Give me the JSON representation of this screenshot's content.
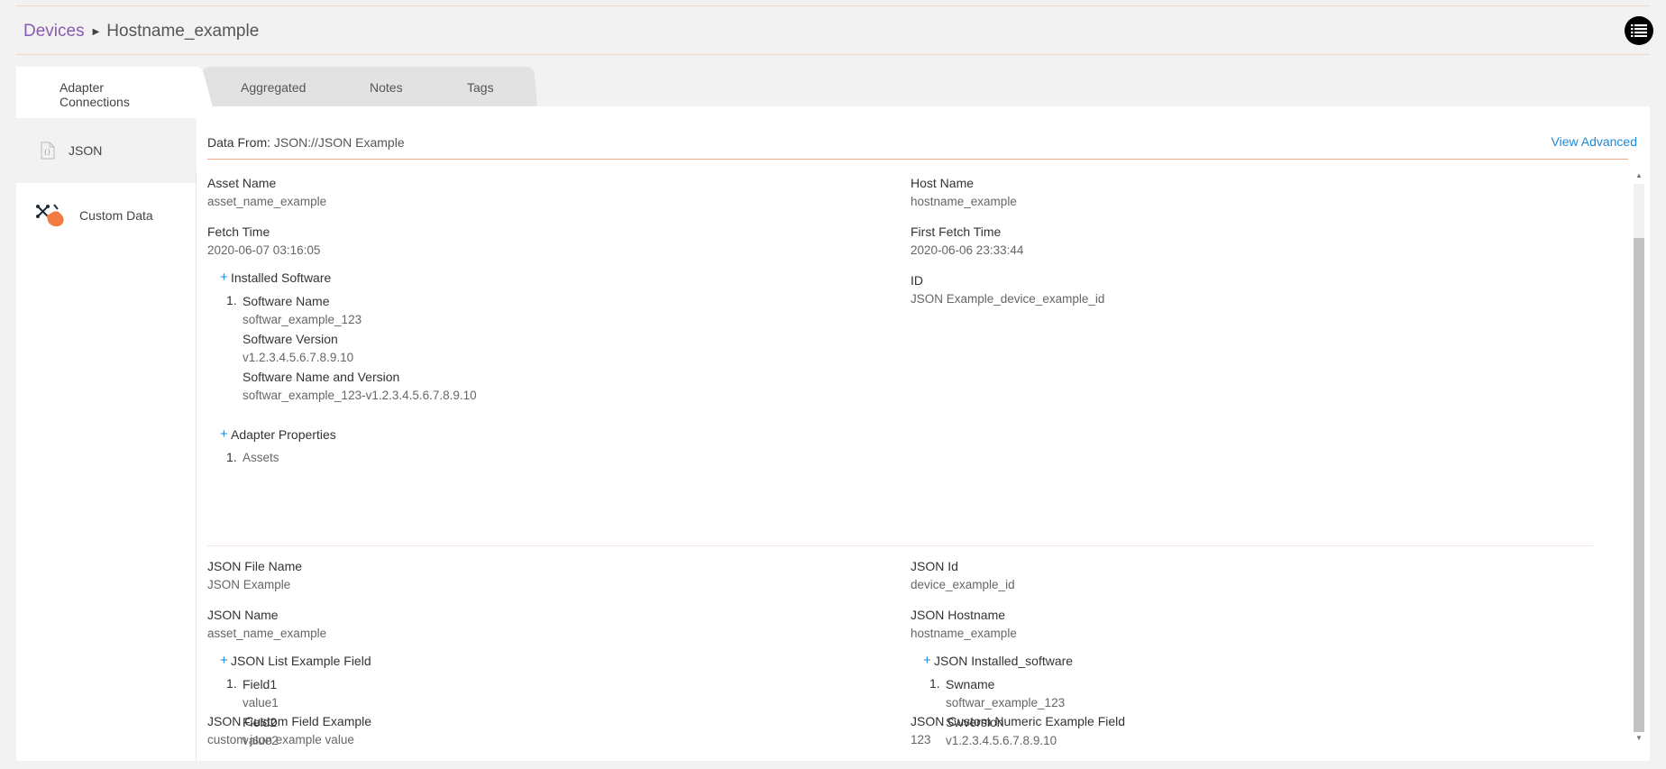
{
  "breadcrumb": {
    "parent": "Devices",
    "current": "Hostname_example"
  },
  "tabs": [
    "Adapter Connections",
    "Aggregated",
    "Notes",
    "Tags"
  ],
  "active_tab": "Adapter Connections",
  "sidebar": {
    "items": [
      {
        "label": "JSON",
        "icon": "json-file-icon"
      },
      {
        "label": "Custom Data",
        "icon": "custom-data-icon"
      }
    ]
  },
  "content": {
    "data_from_label": "Data From:",
    "data_from_value": "JSON://JSON Example",
    "view_advanced": "View Advanced",
    "asset_name": {
      "label": "Asset Name",
      "value": "asset_name_example"
    },
    "host_name": {
      "label": "Host Name",
      "value": "hostname_example"
    },
    "fetch_time": {
      "label": "Fetch Time",
      "value": "2020-06-07 03:16:05"
    },
    "first_fetch_time": {
      "label": "First Fetch Time",
      "value": "2020-06-06 23:33:44"
    },
    "id": {
      "label": "ID",
      "value": "JSON Example_device_example_id"
    },
    "installed_software": {
      "title": "Installed Software",
      "index": "1.",
      "fields": [
        {
          "label": "Software Name",
          "value": "softwar_example_123"
        },
        {
          "label": "Software Version",
          "value": "v1.2.3.4.5.6.7.8.9.10"
        },
        {
          "label": "Software Name and Version",
          "value": "softwar_example_123-v1.2.3.4.5.6.7.8.9.10"
        }
      ]
    },
    "adapter_properties": {
      "title": "Adapter Properties",
      "index": "1.",
      "value": "Assets"
    },
    "json_file_name": {
      "label": "JSON File Name",
      "value": "JSON Example"
    },
    "json_id": {
      "label": "JSON Id",
      "value": "device_example_id"
    },
    "json_name": {
      "label": "JSON Name",
      "value": "asset_name_example"
    },
    "json_hostname": {
      "label": "JSON Hostname",
      "value": "hostname_example"
    },
    "json_list_field": {
      "title": "JSON List Example Field",
      "index": "1.",
      "fields": [
        {
          "label": "Field1",
          "value": "value1"
        },
        {
          "label": "Field2",
          "value": "value2"
        }
      ]
    },
    "json_installed_software": {
      "title": "JSON Installed_software",
      "index": "1.",
      "fields": [
        {
          "label": "Swname",
          "value": "softwar_example_123"
        },
        {
          "label": "Swversion",
          "value": "v1.2.3.4.5.6.7.8.9.10"
        }
      ]
    },
    "json_custom_field": {
      "label": "JSON Custom Field Example",
      "value": "custom json example value"
    },
    "json_custom_numeric": {
      "label": "JSON Custom Numeric Example Field",
      "value": "123"
    }
  },
  "colors": {
    "link": "#8a5bb5",
    "accent": "#1a8ad9",
    "divider": "#f7a88b",
    "custom_data_icon": "#f47c42"
  }
}
